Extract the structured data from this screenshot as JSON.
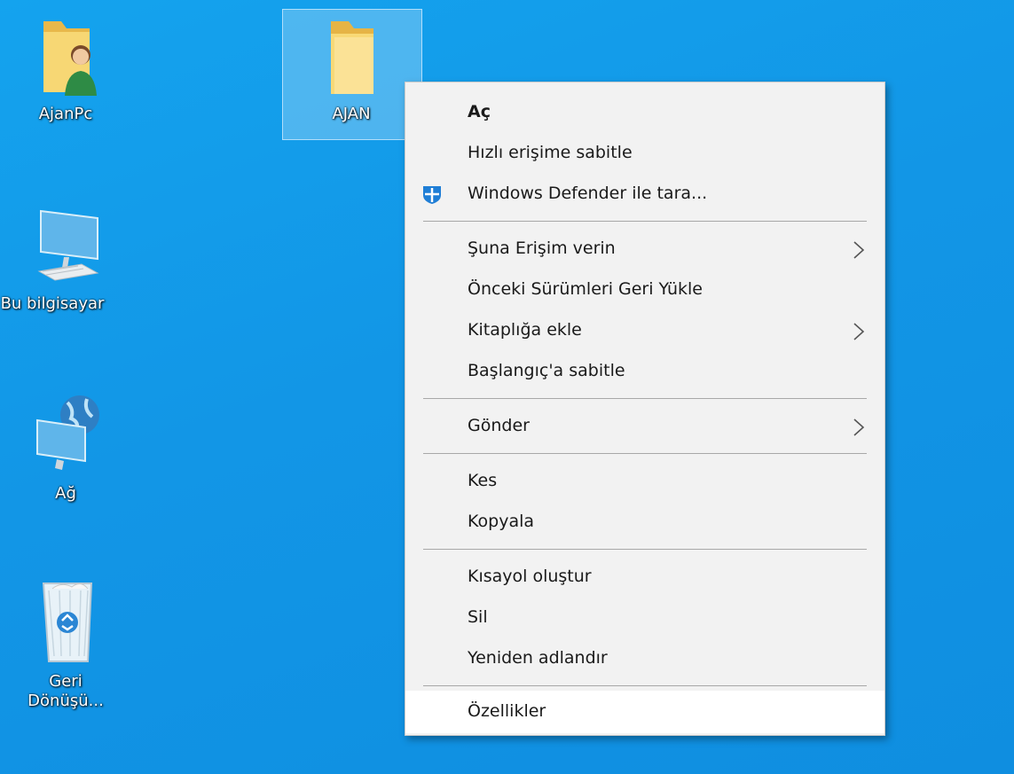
{
  "desktop": {
    "icons": [
      {
        "label": "AjanPc",
        "icon": "user-folder-icon"
      },
      {
        "label": "AJAN",
        "icon": "folder-icon"
      },
      {
        "label": "Bu bilgisayar",
        "icon": "computer-icon"
      },
      {
        "label": "Ağ",
        "icon": "network-icon"
      },
      {
        "label": "Geri Dönüşü...",
        "icon": "recycle-bin-icon"
      }
    ]
  },
  "context_menu": {
    "items": [
      {
        "label": "Aç",
        "bold": true
      },
      {
        "label": "Hızlı erişime sabitle"
      },
      {
        "label": "Windows Defender ile tara...",
        "icon": "windows-defender-icon"
      },
      {
        "label": "Şuna Erişim verin",
        "submenu": true
      },
      {
        "label": "Önceki Sürümleri Geri Yükle"
      },
      {
        "label": "Kitaplığa ekle",
        "submenu": true
      },
      {
        "label": "Başlangıç'a sabitle"
      },
      {
        "label": "Gönder",
        "submenu": true
      },
      {
        "label": "Kes"
      },
      {
        "label": "Kopyala"
      },
      {
        "label": "Kısayol oluştur"
      },
      {
        "label": "Sil"
      },
      {
        "label": "Yeniden adlandır"
      },
      {
        "label": "Özellikler",
        "highlighted": true
      }
    ]
  },
  "colors": {
    "desktop_bg": "#1296e6",
    "menu_bg": "#f2f2f2",
    "menu_hover": "#ffffff"
  }
}
